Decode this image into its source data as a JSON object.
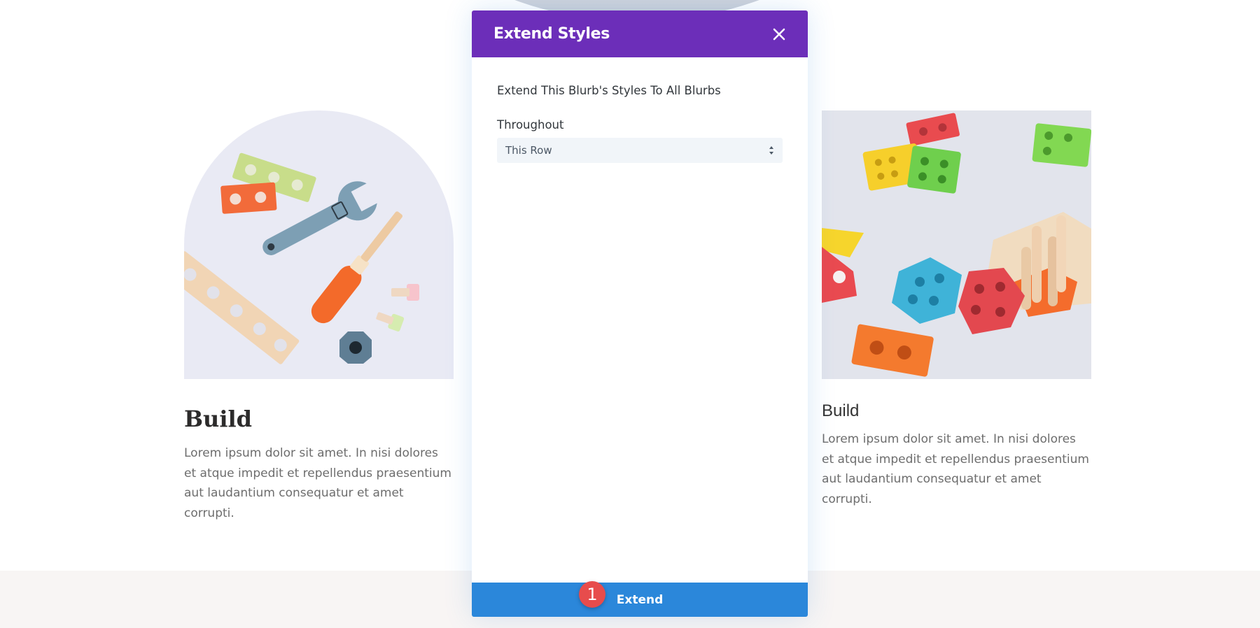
{
  "modal": {
    "title": "Extend Styles",
    "close_icon": "close-icon",
    "subtitle": "Extend This Blurb's Styles To All Blurbs",
    "throughout_label": "Throughout",
    "throughout_value": "This Row",
    "extend_label": "Extend",
    "step_badge": "1",
    "header_color": "#6c2eb9",
    "button_color": "#2b87da"
  },
  "blurbs": [
    {
      "title": "Build",
      "text": "Lorem ipsum dolor sit amet. In nisi dolores et atque impedit et repellendus praesentium aut laudantium consequatur et amet corrupti.",
      "image": "toy-tools-image"
    },
    {
      "title": "Build",
      "text": "Lorem ipsum dolor sit amet. In nisi dolores et atque impedit et repellendus praesentium aut laudantium consequatur et amet corrupti.",
      "image": "shape-sorter-image"
    }
  ]
}
